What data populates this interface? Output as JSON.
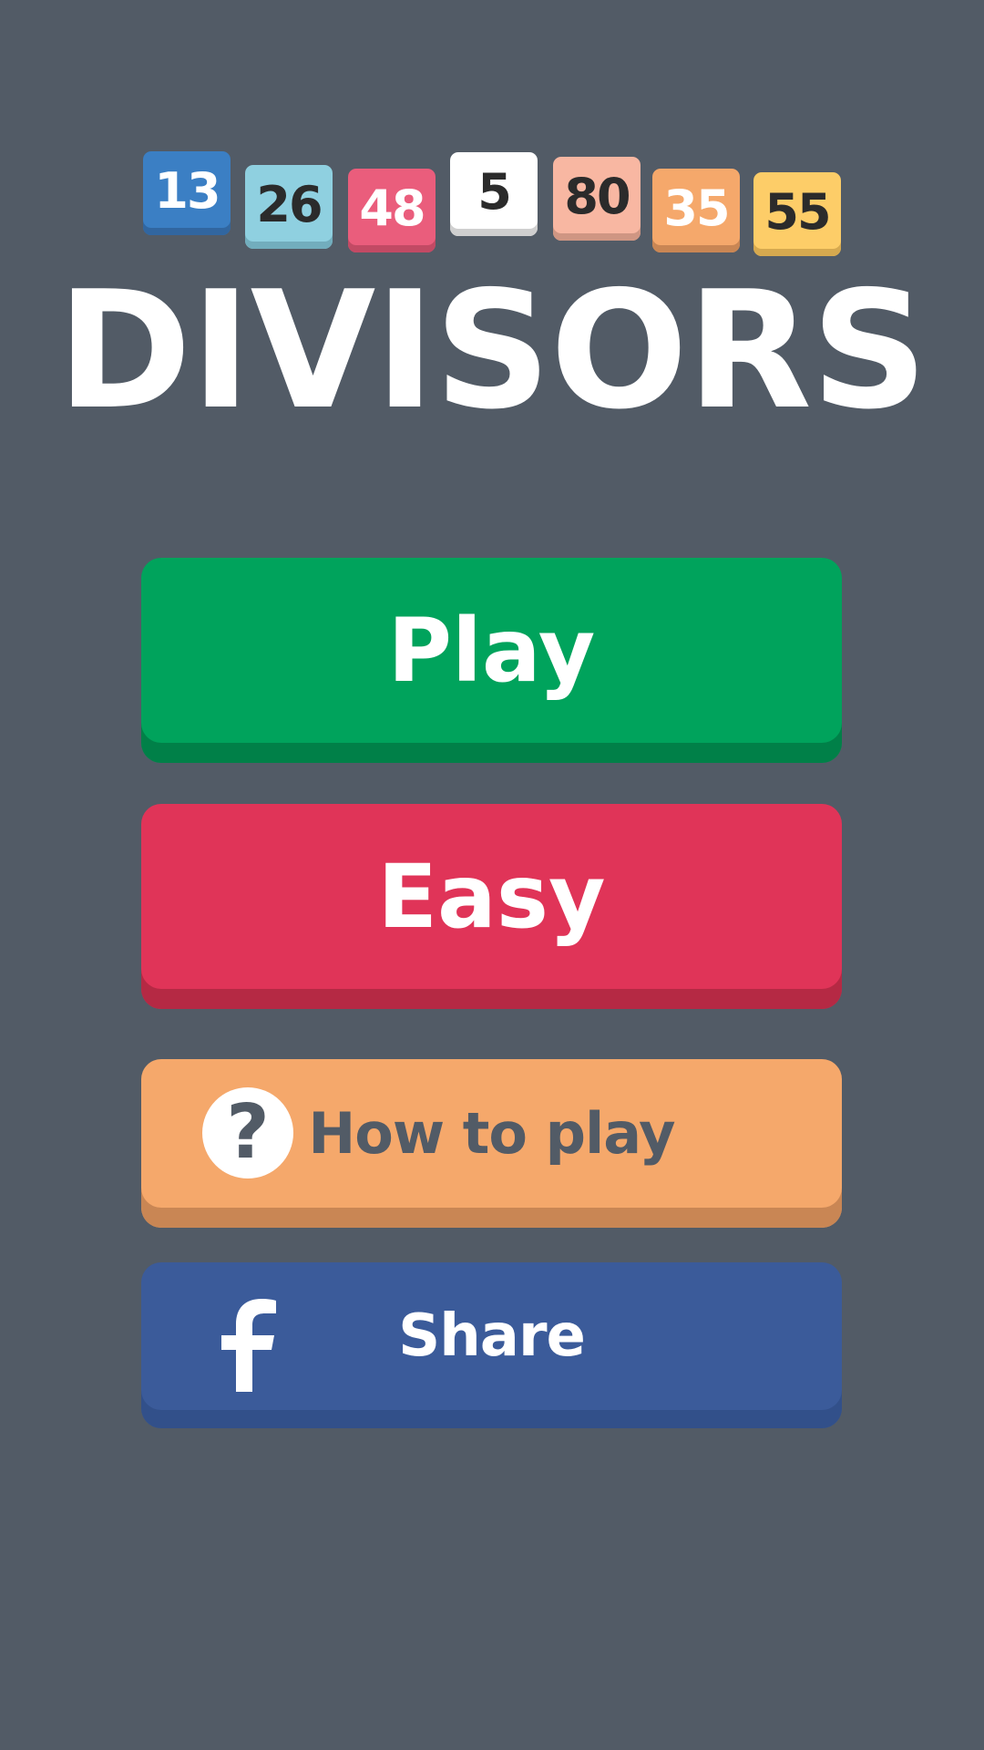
{
  "logo_tiles": [
    {
      "value": "13",
      "bg": "#3b7fc4",
      "fg": "#ffffff",
      "shade": "#3166a0"
    },
    {
      "value": "26",
      "bg": "#8fd0e0",
      "fg": "#2b2b2b",
      "shade": "#72adbd"
    },
    {
      "value": "48",
      "bg": "#ea5d7c",
      "fg": "#ffffff",
      "shade": "#c24a64"
    },
    {
      "value": "5",
      "bg": "#ffffff",
      "fg": "#2b2b2b",
      "shade": "#cfcfcf"
    },
    {
      "value": "80",
      "bg": "#f8b7a2",
      "fg": "#2b2b2b",
      "shade": "#cf9683"
    },
    {
      "value": "35",
      "bg": "#f5a86b",
      "fg": "#ffffff",
      "shade": "#c98654"
    },
    {
      "value": "55",
      "bg": "#fdcd68",
      "fg": "#2b2b2b",
      "shade": "#d6a94f"
    }
  ],
  "title": "DIVISORS",
  "buttons": {
    "play": "Play",
    "easy": "Easy",
    "how_to_play": "How to play",
    "share": "Share"
  },
  "icons": {
    "help": "question-circle-icon",
    "share": "facebook-icon",
    "help_glyph": "?"
  },
  "colors": {
    "background": "#525b66",
    "play": "#00a35c",
    "easy": "#e03458",
    "how_to_play": "#f5a86b",
    "share": "#3b5b9a"
  }
}
